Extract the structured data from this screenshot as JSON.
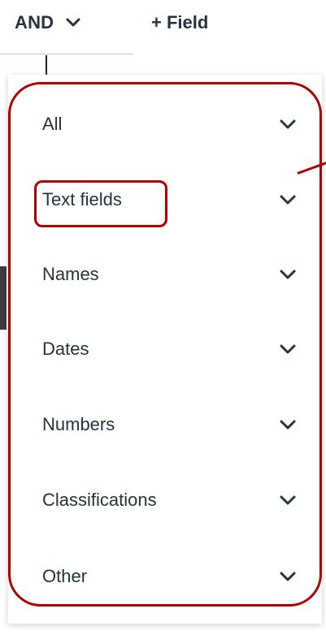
{
  "toolbar": {
    "operator_label": "AND",
    "operator_icon": "chevron-down-icon",
    "add_field_label": "+ Field"
  },
  "dropdown": {
    "items": [
      {
        "label": "All",
        "icon": "chevron-down-icon"
      },
      {
        "label": "Text fields",
        "icon": "chevron-down-icon"
      },
      {
        "label": "Names",
        "icon": "chevron-down-icon"
      },
      {
        "label": "Dates",
        "icon": "chevron-down-icon"
      },
      {
        "label": "Numbers",
        "icon": "chevron-down-icon"
      },
      {
        "label": "Classifications",
        "icon": "chevron-down-icon"
      },
      {
        "label": "Other",
        "icon": "chevron-down-icon"
      }
    ]
  },
  "colors": {
    "text": "#243241",
    "highlight": "#b00000",
    "divider": "#c8c8c8",
    "background": "#ffffff"
  }
}
